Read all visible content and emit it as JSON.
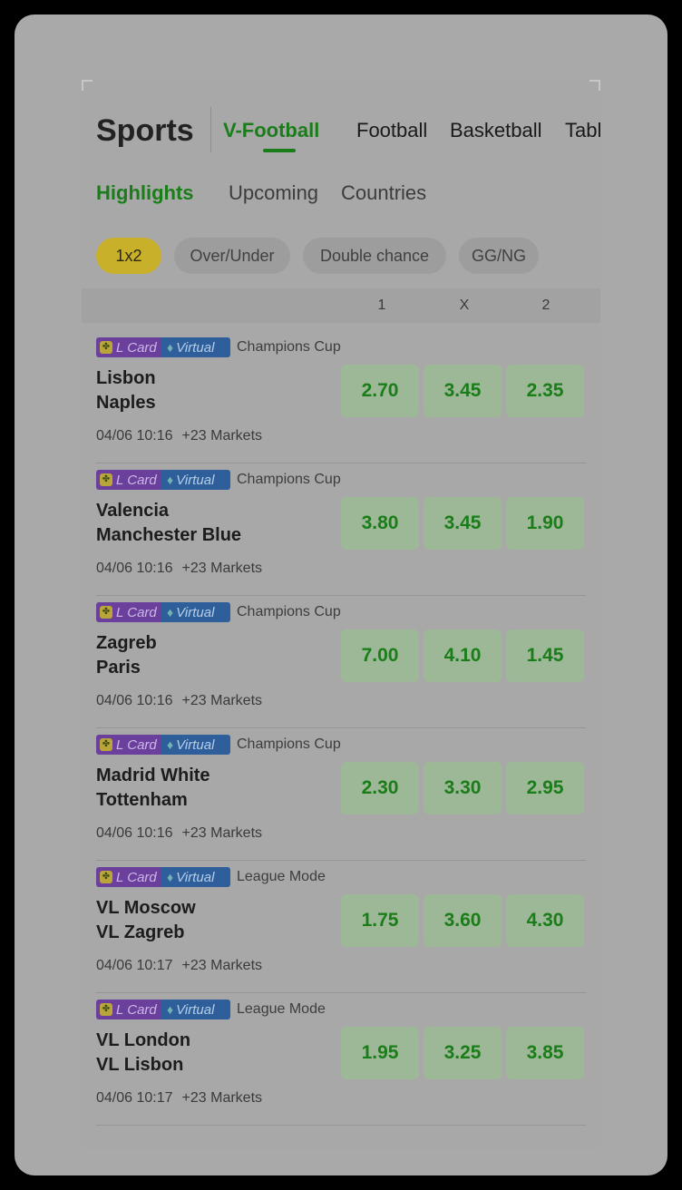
{
  "header": {
    "title": "Sports",
    "tabs": [
      {
        "label": "V-Football",
        "active": true
      },
      {
        "label": "Football",
        "active": false
      },
      {
        "label": "Basketball",
        "active": false
      },
      {
        "label": "Tabl",
        "active": false
      }
    ]
  },
  "subtabs": [
    {
      "label": "Highlights",
      "active": true
    },
    {
      "label": "Upcoming",
      "active": false
    },
    {
      "label": "Countries",
      "active": false
    }
  ],
  "markets": [
    {
      "label": "1x2",
      "active": true
    },
    {
      "label": "Over/Under",
      "active": false
    },
    {
      "label": "Double chance",
      "active": false
    },
    {
      "label": "GG/NG",
      "active": false
    }
  ],
  "odds_header": [
    "1",
    "X",
    "2"
  ],
  "badges": {
    "card": "L Card",
    "virtual": "Virtual"
  },
  "colors": {
    "accent": "#1a7d1a",
    "chip_active": "#c9b02a",
    "card_badge": "#6b3f9c",
    "virtual_badge": "#2f5f9a"
  },
  "matches": [
    {
      "league": "Champions Cup",
      "home": "Lisbon",
      "away": "Naples",
      "time": "04/06 10:16",
      "markets": "+23 Markets",
      "odds": [
        "2.70",
        "3.45",
        "2.35"
      ]
    },
    {
      "league": "Champions Cup",
      "home": "Valencia",
      "away": "Manchester Blue",
      "time": "04/06 10:16",
      "markets": "+23 Markets",
      "odds": [
        "3.80",
        "3.45",
        "1.90"
      ]
    },
    {
      "league": "Champions Cup",
      "home": "Zagreb",
      "away": "Paris",
      "time": "04/06 10:16",
      "markets": "+23 Markets",
      "odds": [
        "7.00",
        "4.10",
        "1.45"
      ]
    },
    {
      "league": "Champions Cup",
      "home": "Madrid White",
      "away": "Tottenham",
      "time": "04/06 10:16",
      "markets": "+23 Markets",
      "odds": [
        "2.30",
        "3.30",
        "2.95"
      ]
    },
    {
      "league": "League Mode",
      "home": "VL Moscow",
      "away": "VL Zagreb",
      "time": "04/06 10:17",
      "markets": "+23 Markets",
      "odds": [
        "1.75",
        "3.60",
        "4.30"
      ]
    },
    {
      "league": "League Mode",
      "home": "VL London",
      "away": "VL Lisbon",
      "time": "04/06 10:17",
      "markets": "+23 Markets",
      "odds": [
        "1.95",
        "3.25",
        "3.85"
      ]
    }
  ]
}
